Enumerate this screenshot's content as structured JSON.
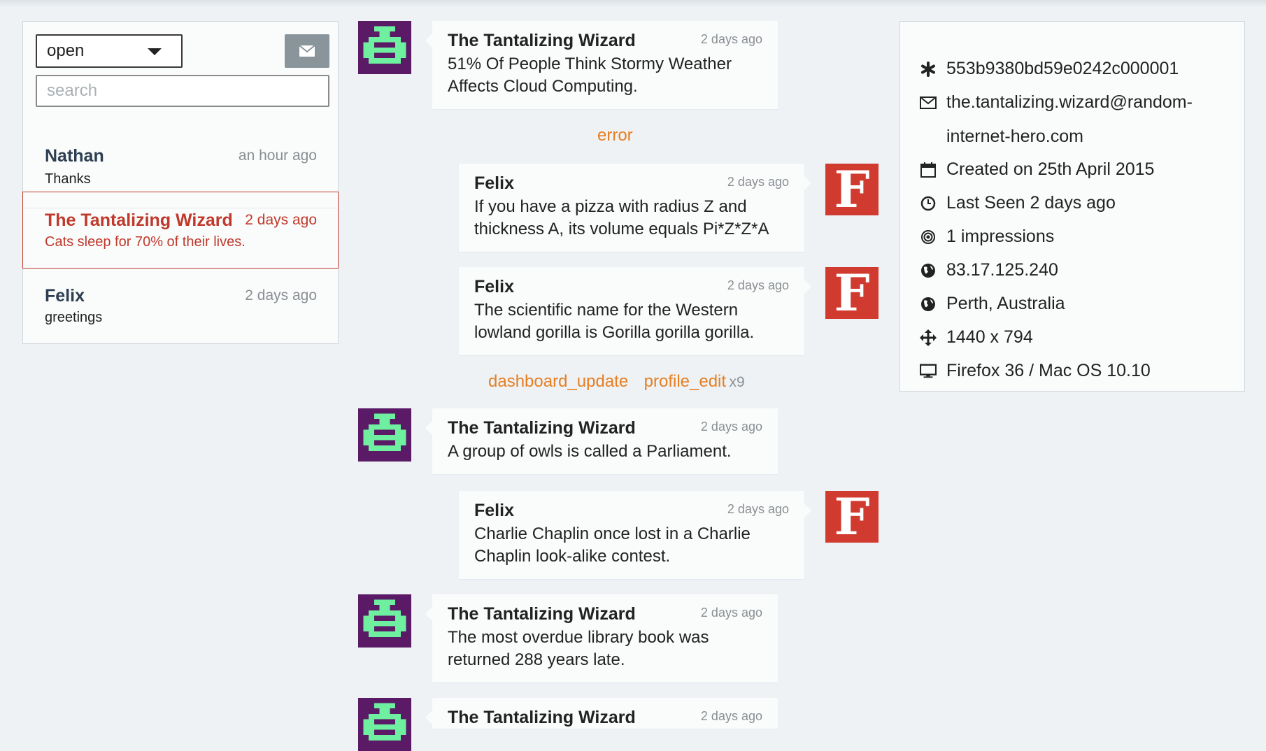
{
  "sidebar": {
    "status_value": "open",
    "search_placeholder": "search",
    "conversations": [
      {
        "name": "Nathan",
        "time": "an hour ago",
        "snippet": "Thanks"
      },
      {
        "name": "The Tantalizing Wizard",
        "time": "2 days ago",
        "snippet": "Cats sleep for 70% of their lives."
      },
      {
        "name": "Felix",
        "time": "2 days ago",
        "snippet": "greetings"
      }
    ]
  },
  "thread": {
    "messages": [
      {
        "author": "The Tantalizing Wizard",
        "time": "2 days ago",
        "lines": [
          "51% Of People Think Stormy Weather",
          "Affects Cloud Computing."
        ]
      },
      {
        "author": "Felix",
        "time": "2 days ago",
        "lines": [
          "If you have a pizza with radius Z and",
          "thickness A, its volume equals Pi*Z*Z*A"
        ]
      },
      {
        "author": "Felix",
        "time": "2 days ago",
        "lines": [
          "The scientific name for the Western",
          "lowland gorilla is Gorilla gorilla gorilla."
        ]
      },
      {
        "author": "The Tantalizing Wizard",
        "time": "2 days ago",
        "lines": [
          "A group of owls is called a Parliament."
        ]
      },
      {
        "author": "Felix",
        "time": "2 days ago",
        "lines": [
          "Charlie Chaplin once lost in a Charlie",
          "Chaplin look-alike contest."
        ]
      },
      {
        "author": "The Tantalizing Wizard",
        "time": "2 days ago",
        "lines": [
          "The most overdue library book was",
          "returned 288 years late."
        ]
      },
      {
        "author": "The Tantalizing Wizard",
        "time": "2 days ago",
        "lines": []
      }
    ],
    "events": {
      "error": "error",
      "dashboard_update": "dashboard_update",
      "profile_edit": "profile_edit",
      "profile_edit_count": "x9"
    },
    "felix_avatar_letter": "F"
  },
  "profile": {
    "id": "553b9380bd59e0242c000001",
    "email_line1": "the.tantalizing.wizard@random-",
    "email_line2": "internet-hero.com",
    "created": "Created on 25th April 2015",
    "last_seen": "Last Seen 2 days ago",
    "impressions": "1 impressions",
    "ip": "83.17.125.240",
    "location": "Perth, Australia",
    "resolution": "1440 x 794",
    "browser": "Firefox 36 / Mac OS 10.10",
    "icons": [
      "asterisk-icon",
      "envelope-icon",
      "calendar-icon",
      "clock-icon",
      "target-icon",
      "globe-icon",
      "globe-icon",
      "move-arrows-icon",
      "monitor-icon"
    ]
  },
  "colors": {
    "accent_red": "#c0392b",
    "event_orange": "#e67e22",
    "avatar_purple": "#5a1a66",
    "avatar_green": "#6ef0a0",
    "felix_red": "#d03a2f"
  }
}
